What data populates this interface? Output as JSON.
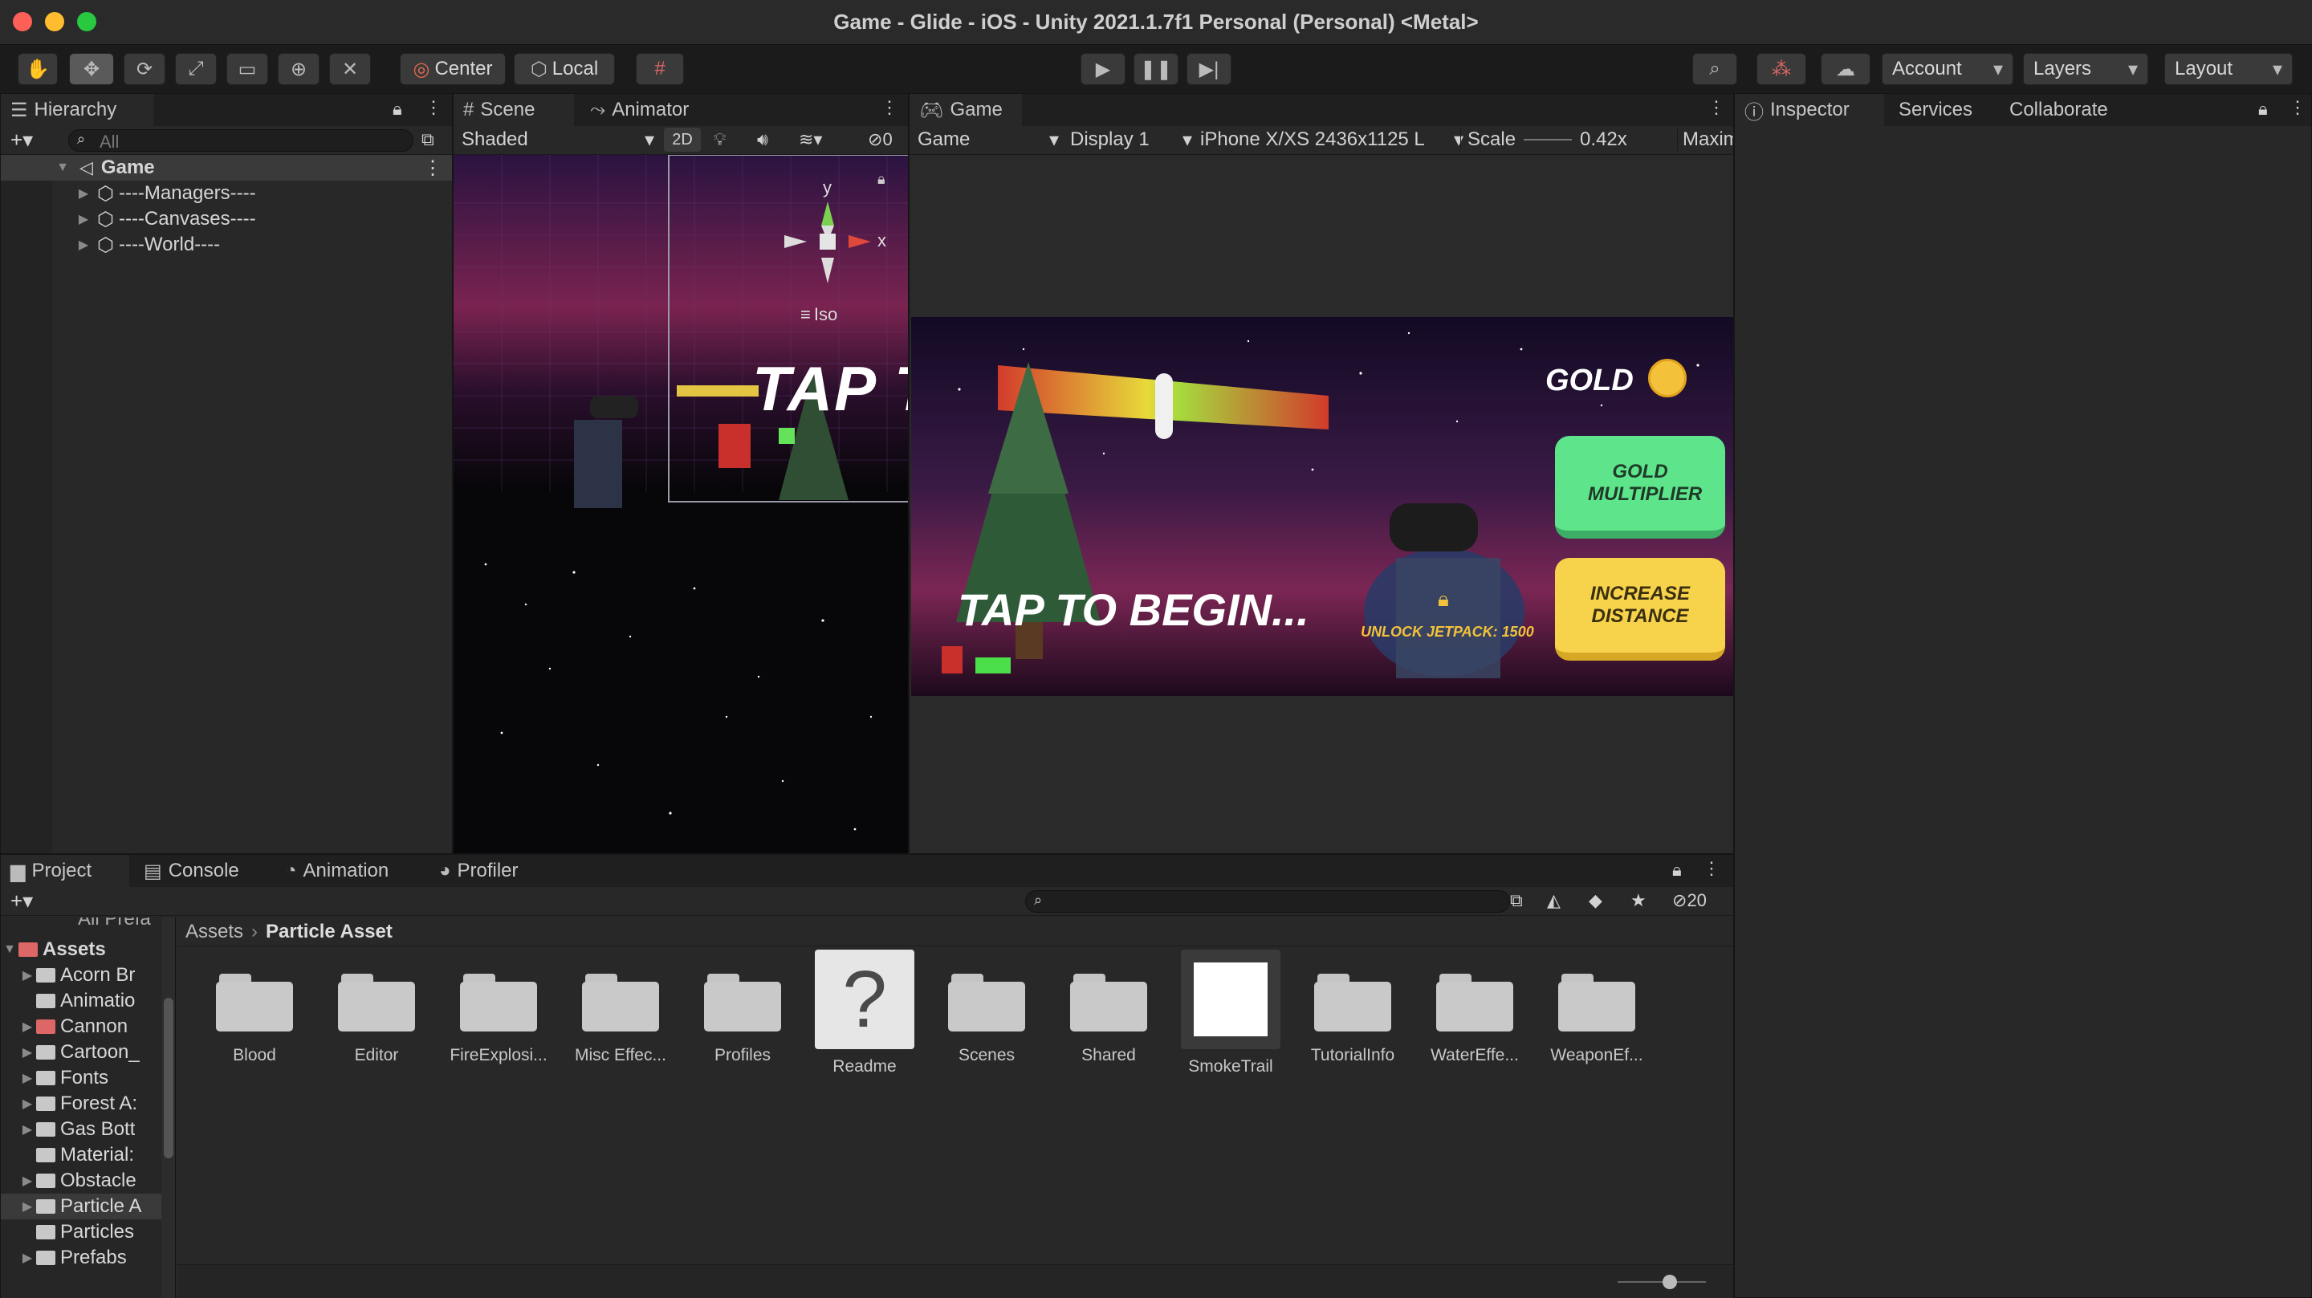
{
  "window": {
    "title": "Game - Glide - iOS - Unity 2021.1.7f1 Personal (Personal) <Metal>"
  },
  "toolbar": {
    "pivot_label": "Center",
    "space_label": "Local",
    "account_label": "Account",
    "layers_label": "Layers",
    "layout_label": "Layout"
  },
  "hierarchy": {
    "tab_label": "Hierarchy",
    "search_placeholder": "All",
    "scene_name": "Game",
    "items": [
      "----Managers----",
      "----Canvases----",
      "----World----"
    ]
  },
  "scene_view": {
    "tab_label": "Scene",
    "animator_tab_label": "Animator",
    "shading_mode": "Shaded",
    "mode_2d": "2D",
    "hidden_count": "0",
    "gizmo_y": "y",
    "gizmo_x": "x",
    "projection": "Iso",
    "overlay_text": "TAP TO"
  },
  "game_view": {
    "tab_label": "Game",
    "game_dropdown": "Game",
    "display": "Display 1",
    "resolution": "iPhone X/XS 2436x1125 L",
    "scale_label": "Scale",
    "scale_value": "0.42x",
    "maximize": "Maximize",
    "hud": {
      "gold_label": "GOLD",
      "gold_multiplier_button": "GOLD MULTIPLIER",
      "increase_distance_button": "INCREASE DISTANCE",
      "tap_to_begin": "TAP TO BEGIN...",
      "unlock_label": "UNLOCK JETPACK: 1500"
    }
  },
  "inspector": {
    "tab_label": "Inspector",
    "services_label": "Services",
    "collaborate_label": "Collaborate"
  },
  "project": {
    "tabs": [
      "Project",
      "Console",
      "Animation",
      "Profiler"
    ],
    "hidden_count": "20",
    "breadcrumb_root": "Assets",
    "breadcrumb_current": "Particle Asset",
    "tree_partial_top": "All Prefa",
    "tree_root": "Assets",
    "tree_items": [
      "Acorn Br",
      "Animatio",
      "Cannon",
      "Cartoon_",
      "Fonts",
      "Forest A:",
      "Gas Bott",
      "Material:",
      "Obstacle",
      "Particle A",
      "Particles",
      "Prefabs"
    ],
    "assets": [
      "Blood",
      "Editor",
      "FireExplosi...",
      "Misc Effec...",
      "Profiles",
      "Readme",
      "Scenes",
      "Shared",
      "SmokeTrail",
      "TutorialInfo",
      "WaterEffe...",
      "WeaponEf..."
    ]
  },
  "colors": {
    "gold_button": "#5ee58b",
    "distance_button": "#f7d34c",
    "panel": "#282828",
    "editor_bg": "#1e1e1e"
  }
}
